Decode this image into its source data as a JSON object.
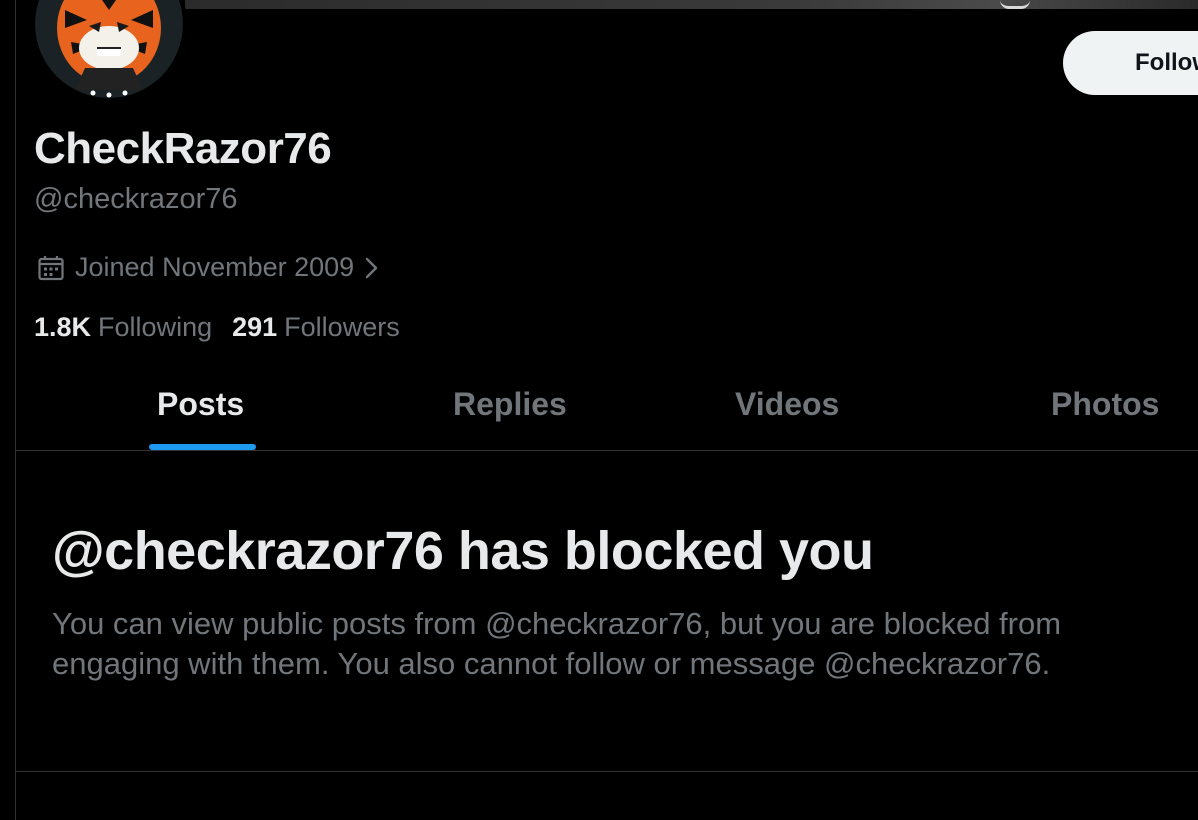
{
  "profile": {
    "display_name": "CheckRazor76",
    "handle": "@checkrazor76",
    "joined": "Joined November 2009",
    "following_count": "1.8K",
    "following_label": "Following",
    "followers_count": "291",
    "followers_label": "Followers"
  },
  "actions": {
    "follow_label": "Follow"
  },
  "tabs": [
    {
      "label": "Posts",
      "active": true
    },
    {
      "label": "Replies",
      "active": false
    },
    {
      "label": "Videos",
      "active": false
    },
    {
      "label": "Photos",
      "active": false
    }
  ],
  "blocked": {
    "title": "@checkrazor76 has blocked you",
    "body": "You can view public posts from @checkrazor76, but you are blocked from engaging with them. You also cannot follow or message @checkrazor76."
  },
  "icons": {
    "calendar": "calendar-icon",
    "chevron": "chevron-right-icon"
  },
  "colors": {
    "background": "#000000",
    "primary_text": "#e7e9ea",
    "secondary_text": "#71767b",
    "accent": "#1d9bf0",
    "divider": "#2f3336",
    "follow_button": "#eff3f4"
  }
}
